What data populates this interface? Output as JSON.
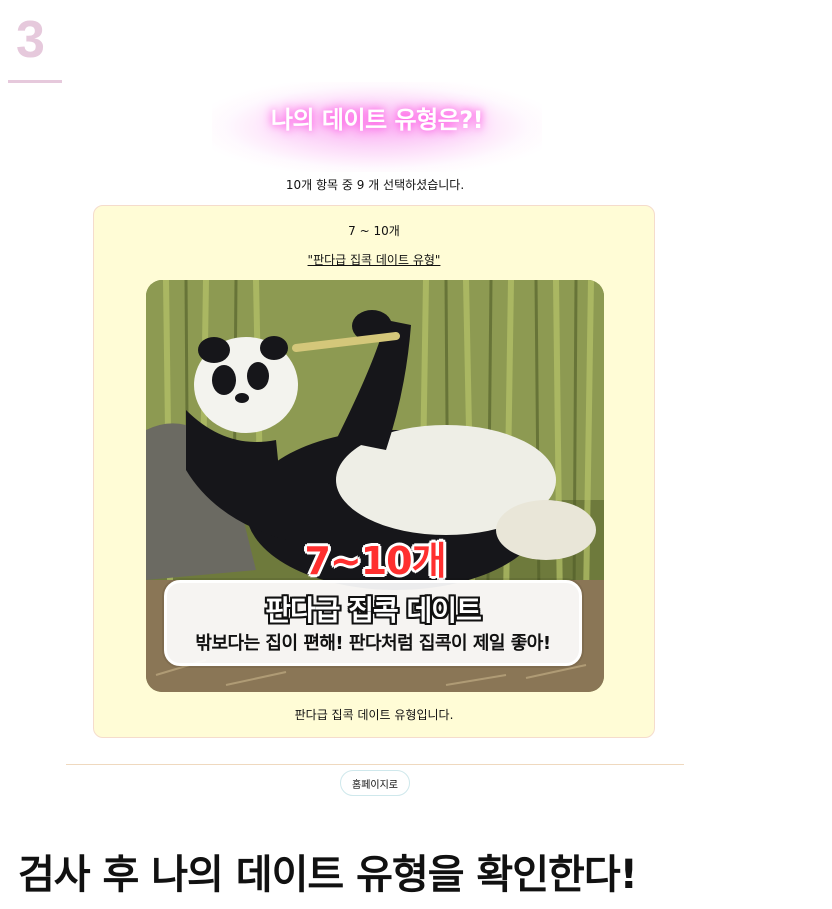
{
  "step": {
    "number": "3"
  },
  "header": {
    "title": "나의 데이트 유형은?!"
  },
  "selection": {
    "summary": "10개 항목 중 9 개 선택하셨습니다."
  },
  "result": {
    "range_label": "7 ~ 10개",
    "type_link": "\"판다급 집콕 데이트 유형\"",
    "image": {
      "count_text": "7~10개",
      "banner_title": "판다급 집콕 데이트",
      "banner_subtitle": "밖보다는 집이 편해! 판다처럼 집콕이 제일 좋아!",
      "subject": "panda-photo"
    },
    "description": "판다급 집콕 데이트 유형입니다."
  },
  "footer": {
    "home_button_label": "홈페이지로"
  },
  "caption": {
    "text": "검사 후 나의 데이트 유형을 확인한다!"
  },
  "colors": {
    "step_accent": "#e6c9dc",
    "title_glow": "#ff4fe3",
    "card_background": "#fffcd6",
    "image_count": "#ff2f2f"
  }
}
